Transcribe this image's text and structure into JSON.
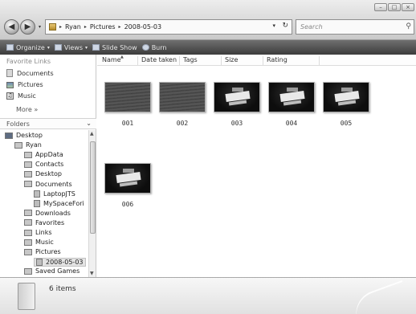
{
  "window": {
    "minimize_glyph": "–",
    "maximize_glyph": "□",
    "close_glyph": "×"
  },
  "address_bar": {
    "crumbs": [
      "Ryan",
      "Pictures",
      "2008-05-03"
    ],
    "separator": "▸",
    "refresh_glyph": "↻"
  },
  "search": {
    "placeholder": "Search"
  },
  "toolbar": {
    "organize": "Organize",
    "views": "Views",
    "slideshow": "Slide Show",
    "burn": "Burn",
    "dropdown_glyph": "▾"
  },
  "favorite_links": {
    "heading": "Favorite Links",
    "items": [
      "Documents",
      "Pictures",
      "Music"
    ],
    "more": "More »"
  },
  "folders": {
    "heading": "Folders",
    "tree": [
      {
        "label": "Desktop",
        "level": 0
      },
      {
        "label": "Ryan",
        "level": 1
      },
      {
        "label": "AppData",
        "level": 2
      },
      {
        "label": "Contacts",
        "level": 2
      },
      {
        "label": "Desktop",
        "level": 2
      },
      {
        "label": "Documents",
        "level": 2
      },
      {
        "label": "LaptopJTS",
        "level": 3
      },
      {
        "label": "MySpaceFori",
        "level": 3
      },
      {
        "label": "Downloads",
        "level": 2
      },
      {
        "label": "Favorites",
        "level": 2
      },
      {
        "label": "Links",
        "level": 2
      },
      {
        "label": "Music",
        "level": 2
      },
      {
        "label": "Pictures",
        "level": 2
      },
      {
        "label": "2008-05-03",
        "level": 3,
        "selected": true
      },
      {
        "label": "Saved Games",
        "level": 2
      }
    ]
  },
  "columns": [
    "Name",
    "Date taken",
    "Tags",
    "Size",
    "Rating"
  ],
  "files": [
    {
      "name": "001",
      "kind": "water"
    },
    {
      "name": "002",
      "kind": "water"
    },
    {
      "name": "003",
      "kind": "sign"
    },
    {
      "name": "004",
      "kind": "sign"
    },
    {
      "name": "005",
      "kind": "sign"
    },
    {
      "name": "006",
      "kind": "sign"
    }
  ],
  "details": {
    "item_count": "6 items"
  }
}
